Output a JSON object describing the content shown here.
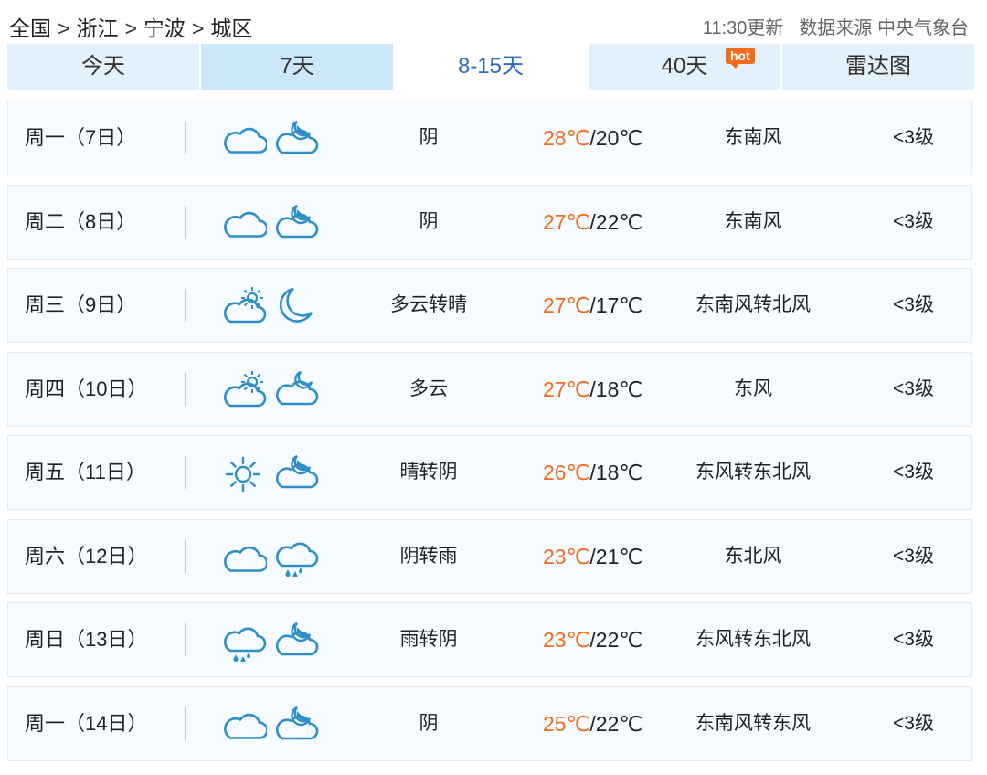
{
  "breadcrumb": [
    "全国",
    "浙江",
    "宁波",
    "城区"
  ],
  "breadcrumb_sep": ">",
  "meta": {
    "updated": "11:30更新",
    "source": "数据来源 中央气象台"
  },
  "tabs": [
    {
      "label": "今天",
      "state": "normal"
    },
    {
      "label": "7天",
      "state": "selected"
    },
    {
      "label": "8-15天",
      "state": "active"
    },
    {
      "label": "40天",
      "state": "normal",
      "badge": "hot"
    },
    {
      "label": "雷达图",
      "state": "normal"
    }
  ],
  "colors": {
    "accent": "#2b6bc6",
    "high_temp": "#f26b1d",
    "icon": "#2e8fc7",
    "badge": "#f26b1d"
  },
  "days": [
    {
      "day": "周一（7日）",
      "icon_day": "cloudy-icon",
      "icon_night": "cloudy-night-icon",
      "weather": "阴",
      "high": "28℃",
      "low": "/20℃",
      "wind": "东南风",
      "level": "<3级"
    },
    {
      "day": "周二（8日）",
      "icon_day": "cloudy-icon",
      "icon_night": "cloudy-night-icon",
      "weather": "阴",
      "high": "27℃",
      "low": "/22℃",
      "wind": "东南风",
      "level": "<3级"
    },
    {
      "day": "周三（9日）",
      "icon_day": "partly-cloudy-day-icon",
      "icon_night": "moon-icon",
      "weather": "多云转晴",
      "high": "27℃",
      "low": "/17℃",
      "wind": "东南风转北风",
      "level": "<3级"
    },
    {
      "day": "周四（10日）",
      "icon_day": "partly-cloudy-day-icon",
      "icon_night": "partly-cloudy-night-icon",
      "weather": "多云",
      "high": "27℃",
      "low": "/18℃",
      "wind": "东风",
      "level": "<3级"
    },
    {
      "day": "周五（11日）",
      "icon_day": "sun-icon",
      "icon_night": "cloudy-night-icon",
      "weather": "晴转阴",
      "high": "26℃",
      "low": "/18℃",
      "wind": "东风转东北风",
      "level": "<3级"
    },
    {
      "day": "周六（12日）",
      "icon_day": "cloudy-icon",
      "icon_night": "rain-icon",
      "weather": "阴转雨",
      "high": "23℃",
      "low": "/21℃",
      "wind": "东北风",
      "level": "<3级"
    },
    {
      "day": "周日（13日）",
      "icon_day": "rain-icon",
      "icon_night": "cloudy-night-icon",
      "weather": "雨转阴",
      "high": "23℃",
      "low": "/22℃",
      "wind": "东风转东北风",
      "level": "<3级"
    },
    {
      "day": "周一（14日）",
      "icon_day": "cloudy-icon",
      "icon_night": "cloudy-night-icon",
      "weather": "阴",
      "high": "25℃",
      "low": "/22℃",
      "wind": "东南风转东风",
      "level": "<3级"
    }
  ]
}
